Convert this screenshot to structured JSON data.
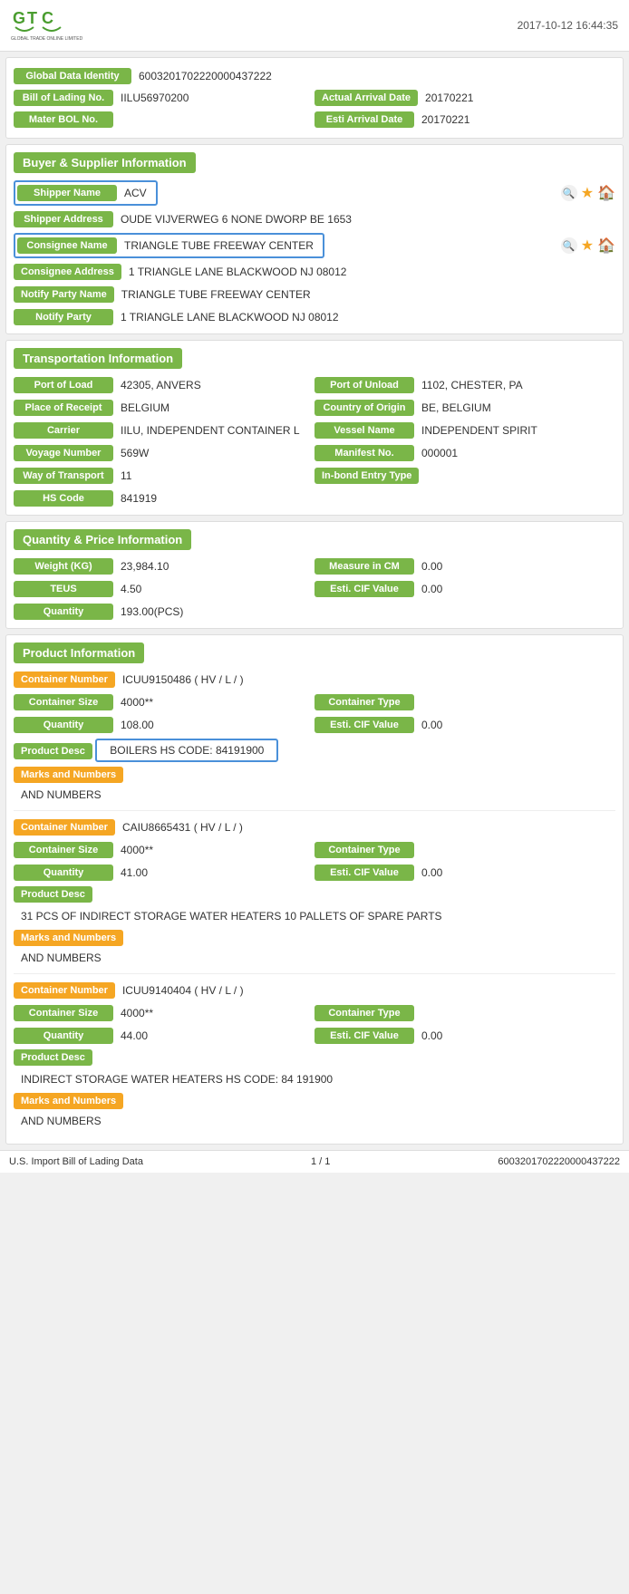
{
  "header": {
    "datetime": "2017-10-12 16:44:35"
  },
  "top_info": {
    "global_data_identity_label": "Global Data Identity",
    "global_data_identity_value": "60032017022200004​37222",
    "bill_of_lading_label": "Bill of Lading No.",
    "bill_of_lading_value": "IILU56970200",
    "actual_arrival_date_label": "Actual Arrival Date",
    "actual_arrival_date_value": "20170221",
    "mater_bol_label": "Mater BOL No.",
    "mater_bol_value": "",
    "esti_arrival_date_label": "Esti Arrival Date",
    "esti_arrival_date_value": "20170221"
  },
  "buyer_supplier": {
    "title": "Buyer & Supplier Information",
    "shipper_name_label": "Shipper Name",
    "shipper_name_value": "ACV",
    "shipper_address_label": "Shipper Address",
    "shipper_address_value": "OUDE VIJVERWEG 6 NONE DWORP BE 1653",
    "consignee_name_label": "Consignee Name",
    "consignee_name_value": "TRIANGLE TUBE FREEWAY CENTER",
    "consignee_address_label": "Consignee Address",
    "consignee_address_value": "1 TRIANGLE LANE BLACKWOOD NJ 08012",
    "notify_party_name_label": "Notify Party Name",
    "notify_party_name_value": "TRIANGLE TUBE FREEWAY CENTER",
    "notify_party_label": "Notify Party",
    "notify_party_value": "1 TRIANGLE LANE BLACKWOOD NJ 08012"
  },
  "transportation": {
    "title": "Transportation Information",
    "port_of_load_label": "Port of Load",
    "port_of_load_value": "42305, ANVERS",
    "port_of_unload_label": "Port of Unload",
    "port_of_unload_value": "1102, CHESTER, PA",
    "place_of_receipt_label": "Place of Receipt",
    "place_of_receipt_value": "BELGIUM",
    "country_of_origin_label": "Country of Origin",
    "country_of_origin_value": "BE, BELGIUM",
    "carrier_label": "Carrier",
    "carrier_value": "IILU, INDEPENDENT CONTAINER L",
    "vessel_name_label": "Vessel Name",
    "vessel_name_value": "INDEPENDENT SPIRIT",
    "voyage_number_label": "Voyage Number",
    "voyage_number_value": "569W",
    "manifest_no_label": "Manifest No.",
    "manifest_no_value": "000001",
    "way_of_transport_label": "Way of Transport",
    "way_of_transport_value": "11",
    "in_bond_entry_type_label": "In-bond Entry Type",
    "in_bond_entry_type_value": "",
    "hs_code_label": "HS Code",
    "hs_code_value": "841919"
  },
  "quantity_price": {
    "title": "Quantity & Price Information",
    "weight_kg_label": "Weight (KG)",
    "weight_kg_value": "23,984.10",
    "measure_in_cm_label": "Measure in CM",
    "measure_in_cm_value": "0.00",
    "teus_label": "TEUS",
    "teus_value": "4.50",
    "esti_cif_value_label": "Esti. CIF Value",
    "esti_cif_value_value": "0.00",
    "quantity_label": "Quantity",
    "quantity_value": "193.00(PCS)"
  },
  "product_info": {
    "title": "Product Information",
    "containers": [
      {
        "container_number_label": "Container Number",
        "container_number_value": "ICUU9150486 ( HV / L / )",
        "container_size_label": "Container Size",
        "container_size_value": "4000**",
        "container_type_label": "Container Type",
        "container_type_value": "",
        "quantity_label": "Quantity",
        "quantity_value": "108.00",
        "esti_cif_label": "Esti. CIF Value",
        "esti_cif_value": "0.00",
        "product_desc_label": "Product Desc",
        "product_desc_value": "BOILERS HS CODE: 84191900",
        "product_desc_highlighted": true,
        "marks_label": "Marks and Numbers",
        "marks_value": "AND NUMBERS"
      },
      {
        "container_number_label": "Container Number",
        "container_number_value": "CAIU8665431 ( HV / L / )",
        "container_size_label": "Container Size",
        "container_size_value": "4000**",
        "container_type_label": "Container Type",
        "container_type_value": "",
        "quantity_label": "Quantity",
        "quantity_value": "41.00",
        "esti_cif_label": "Esti. CIF Value",
        "esti_cif_value": "0.00",
        "product_desc_label": "Product Desc",
        "product_desc_value": "31 PCS OF INDIRECT STORAGE WATER HEATERS 10 PALLETS OF SPARE PARTS",
        "product_desc_highlighted": false,
        "marks_label": "Marks and Numbers",
        "marks_value": "AND NUMBERS"
      },
      {
        "container_number_label": "Container Number",
        "container_number_value": "ICUU9140404 ( HV / L / )",
        "container_size_label": "Container Size",
        "container_size_value": "4000**",
        "container_type_label": "Container Type",
        "container_type_value": "",
        "quantity_label": "Quantity",
        "quantity_value": "44.00",
        "esti_cif_label": "Esti. CIF Value",
        "esti_cif_value": "0.00",
        "product_desc_label": "Product Desc",
        "product_desc_value": "INDIRECT STORAGE WATER HEATERS HS CODE: 84 191900",
        "product_desc_highlighted": false,
        "marks_label": "Marks and Numbers",
        "marks_value": "AND NUMBERS"
      }
    ]
  },
  "footer": {
    "left_label": "U.S. Import Bill of Lading Data",
    "pagination": "1 / 1",
    "right_id": "60032017022200004​37222"
  }
}
